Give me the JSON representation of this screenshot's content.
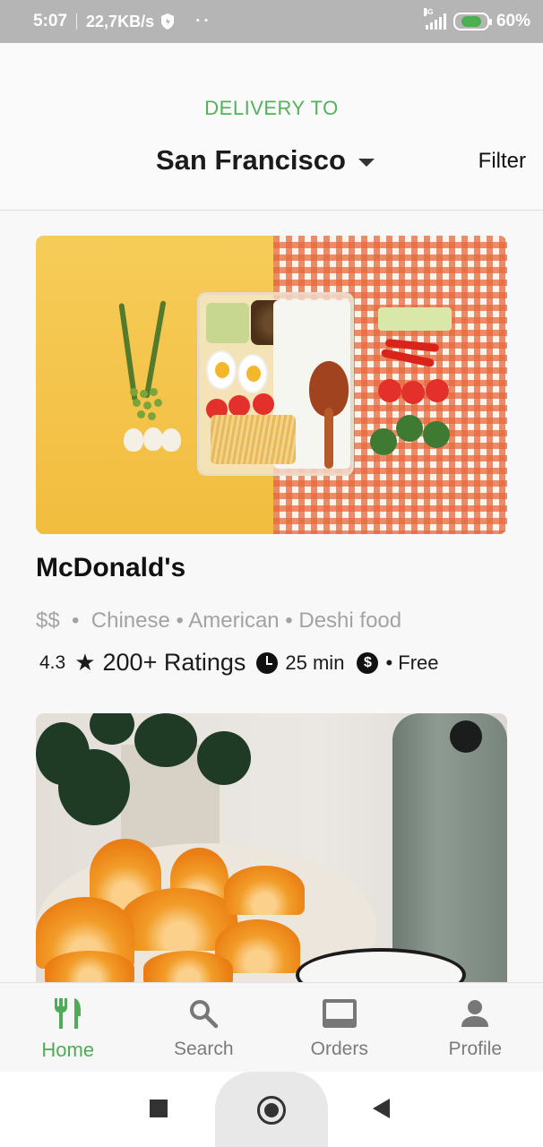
{
  "status_bar": {
    "time": "5:07",
    "speed": "22,7KB/s",
    "dots": "··",
    "network": "4G",
    "battery": "60%"
  },
  "header": {
    "delivery_label": "DELIVERY TO",
    "location": "San Francisco",
    "filter_label": "Filter"
  },
  "restaurants": [
    {
      "name": "McDonald's",
      "price": "$$",
      "cuisines": "Chinese • American • Deshi food",
      "rating": "4.3",
      "ratings_count": "200+ Ratings",
      "delivery_time": "25 min",
      "delivery_fee": "• Free"
    }
  ],
  "bottom_nav": {
    "items": [
      {
        "label": "Home",
        "icon": "restaurant-icon",
        "active": true
      },
      {
        "label": "Search",
        "icon": "search-icon",
        "active": false
      },
      {
        "label": "Orders",
        "icon": "orders-icon",
        "active": false
      },
      {
        "label": "Profile",
        "icon": "person-icon",
        "active": false
      }
    ]
  },
  "colors": {
    "accent": "#53b15b",
    "status_bar": "#b5b5b5"
  }
}
